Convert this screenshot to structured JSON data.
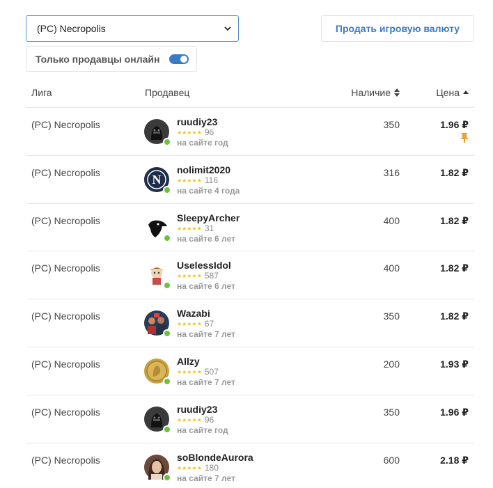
{
  "filters": {
    "league_value": "(PC) Necropolis",
    "sell_button_label": "Продать игровую валюту",
    "online_only_label": "Только продавцы онлайн",
    "online_only_enabled": true
  },
  "table": {
    "headers": {
      "league": "Лига",
      "seller": "Продавец",
      "stock": "Наличие",
      "price": "Цена"
    },
    "rows": [
      {
        "league": "(PC) Necropolis",
        "seller": "ruudiy23",
        "reviews": "96",
        "since": "на сайте год",
        "stock": "350",
        "price": "1.96 ₽",
        "pinned": true,
        "avatar": "darth-vader-avatar"
      },
      {
        "league": "(PC) Necropolis",
        "seller": "nolimit2020",
        "reviews": "116",
        "since": "на сайте 4 года",
        "stock": "316",
        "price": "1.82 ₽",
        "pinned": false,
        "avatar": "letter-n-avatar"
      },
      {
        "league": "(PC) Necropolis",
        "seller": "SleepyArcher",
        "reviews": "31",
        "since": "на сайте 6 лет",
        "stock": "400",
        "price": "1.82 ₽",
        "pinned": false,
        "avatar": "crow-avatar"
      },
      {
        "league": "(PC) Necropolis",
        "seller": "UselessIdol",
        "reviews": "587",
        "since": "на сайте 6 лет",
        "stock": "400",
        "price": "1.82 ₽",
        "pinned": false,
        "avatar": "cartoon-avatar"
      },
      {
        "league": "(PC) Necropolis",
        "seller": "Wazabi",
        "reviews": "67",
        "since": "на сайте 7 лет",
        "stock": "350",
        "price": "1.82 ₽",
        "pinned": false,
        "avatar": "group-photo-avatar"
      },
      {
        "league": "(PC) Necropolis",
        "seller": "Allzy",
        "reviews": "507",
        "since": "на сайте 7 лет",
        "stock": "200",
        "price": "1.93 ₽",
        "pinned": false,
        "avatar": "gold-coin-avatar"
      },
      {
        "league": "(PC) Necropolis",
        "seller": "ruudiy23",
        "reviews": "96",
        "since": "на сайте год",
        "stock": "350",
        "price": "1.96 ₽",
        "pinned": false,
        "avatar": "darth-vader-avatar"
      },
      {
        "league": "(PC) Necropolis",
        "seller": "soBlondeAurora",
        "reviews": "180",
        "since": "на сайте 7 лет",
        "stock": "600",
        "price": "2.18 ₽",
        "pinned": false,
        "avatar": "portrait-avatar"
      }
    ]
  },
  "colors": {
    "accent": "#3a7bc8",
    "online": "#6bc33c",
    "star": "#f5c21b",
    "pin": "#f0a030"
  }
}
